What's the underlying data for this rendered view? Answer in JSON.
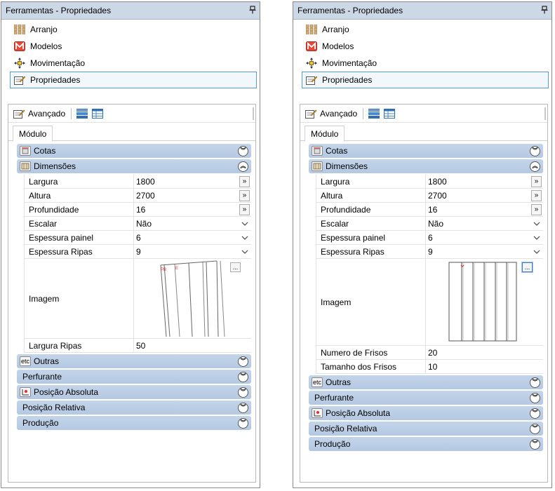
{
  "panels": [
    {
      "title": "Ferramentas - Propriedades",
      "nav": [
        {
          "label": "Arranjo",
          "icon": "arranjo-icon",
          "selected": false
        },
        {
          "label": "Modelos",
          "icon": "modelos-icon",
          "selected": false
        },
        {
          "label": "Movimentação",
          "icon": "move-icon",
          "selected": false
        },
        {
          "label": "Propriedades",
          "icon": "properties-icon",
          "selected": true
        }
      ],
      "toolbar_label": "Avançado",
      "tab": "Módulo",
      "groups": {
        "cotas": "Cotas",
        "dimensoes": "Dimensões",
        "outras": "Outras",
        "perfurante": "Perfurante",
        "posicao_absoluta": "Posição Absoluta",
        "posicao_relativa": "Posição Relativa",
        "producao": "Produção"
      },
      "outras_badge": "etc",
      "dimensions": [
        {
          "label": "Largura",
          "value": "1800",
          "editor": "ellipsis"
        },
        {
          "label": "Altura",
          "value": "2700",
          "editor": "ellipsis"
        },
        {
          "label": "Profundidade",
          "value": "16",
          "editor": "ellipsis"
        },
        {
          "label": "Escalar",
          "value": "Não",
          "editor": "dropdown"
        },
        {
          "label": "Espessura painel",
          "value": "6",
          "editor": "dropdown"
        },
        {
          "label": "Espessura Ripas",
          "value": "9",
          "editor": "dropdown"
        }
      ],
      "image_label": "Imagem",
      "image_button": "...",
      "after_image": [
        {
          "label": "Largura Ripas",
          "value": "50"
        }
      ]
    },
    {
      "title": "Ferramentas - Propriedades",
      "nav": [
        {
          "label": "Arranjo",
          "icon": "arranjo-icon",
          "selected": false
        },
        {
          "label": "Modelos",
          "icon": "modelos-icon",
          "selected": false
        },
        {
          "label": "Movimentação",
          "icon": "move-icon",
          "selected": false
        },
        {
          "label": "Propriedades",
          "icon": "properties-icon",
          "selected": true
        }
      ],
      "toolbar_label": "Avançado",
      "tab": "Módulo",
      "groups": {
        "cotas": "Cotas",
        "dimensoes": "Dimensões",
        "outras": "Outras",
        "perfurante": "Perfurante",
        "posicao_absoluta": "Posição Absoluta",
        "posicao_relativa": "Posição Relativa",
        "producao": "Produção"
      },
      "outras_badge": "etc",
      "dimensions": [
        {
          "label": "Largura",
          "value": "1800",
          "editor": "ellipsis"
        },
        {
          "label": "Altura",
          "value": "2700",
          "editor": "ellipsis"
        },
        {
          "label": "Profundidade",
          "value": "16",
          "editor": "ellipsis"
        },
        {
          "label": "Escalar",
          "value": "Não",
          "editor": "dropdown"
        },
        {
          "label": "Espessura painel",
          "value": "6",
          "editor": "dropdown"
        },
        {
          "label": "Espessura Ripas",
          "value": "9",
          "editor": "dropdown"
        }
      ],
      "image_label": "Imagem",
      "image_button": "...",
      "after_image": [
        {
          "label": "Numero de Frisos",
          "value": "20"
        },
        {
          "label": "Tamanho dos Frisos",
          "value": "10"
        }
      ]
    }
  ],
  "colors": {
    "titlebar": "#cdd8e6",
    "group_header": "#b4c8e2",
    "selection_border": "#5b9bd5",
    "preview_red": "#e03030"
  }
}
